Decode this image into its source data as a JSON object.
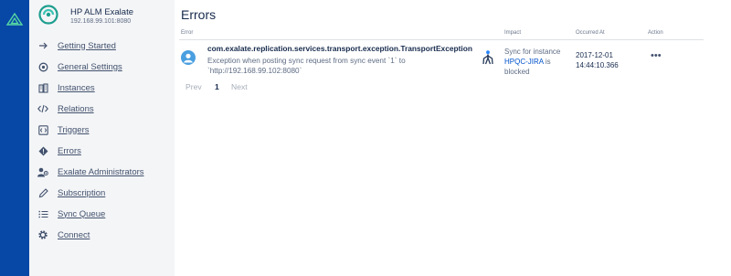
{
  "sidebar": {
    "app_name": "HP ALM Exalate",
    "app_address": "192.168.99.101:8080",
    "items": [
      {
        "label": "Getting Started",
        "icon": "arrow-right-icon"
      },
      {
        "label": "General Settings",
        "icon": "settings-icon"
      },
      {
        "label": "Instances",
        "icon": "building-icon"
      },
      {
        "label": "Relations",
        "icon": "code-icon"
      },
      {
        "label": "Triggers",
        "icon": "trigger-icon"
      },
      {
        "label": "Errors",
        "icon": "error-icon"
      },
      {
        "label": "Exalate Administrators",
        "icon": "admins-icon"
      },
      {
        "label": "Subscription",
        "icon": "pencil-icon"
      },
      {
        "label": "Sync Queue",
        "icon": "list-icon"
      },
      {
        "label": "Connect",
        "icon": "gear-icon"
      }
    ]
  },
  "main": {
    "title": "Errors",
    "columns": {
      "error": "Error",
      "impact": "Impact",
      "occurred_at": "Occurred At",
      "action": "Action"
    },
    "errors": [
      {
        "title": "com.exalate.replication.services.transport.exception.TransportException",
        "message": "Exception when posting sync request from sync event `1` to `http://192.168.99.102:8080`",
        "impact_prefix": "Sync for instance",
        "impact_link": "HPQC-JIRA",
        "impact_suffix": "is blocked",
        "occurred_date": "2017-12-01",
        "occurred_time": "14:44:10.366",
        "action": "•••"
      }
    ],
    "pagination": {
      "prev": "Prev",
      "current": "1",
      "next": "Next"
    }
  },
  "colors": {
    "global_nav": "#0747a6",
    "sidebar_bg": "#f4f5f7",
    "link": "#0052cc",
    "avatar": "#4a9fe0"
  }
}
